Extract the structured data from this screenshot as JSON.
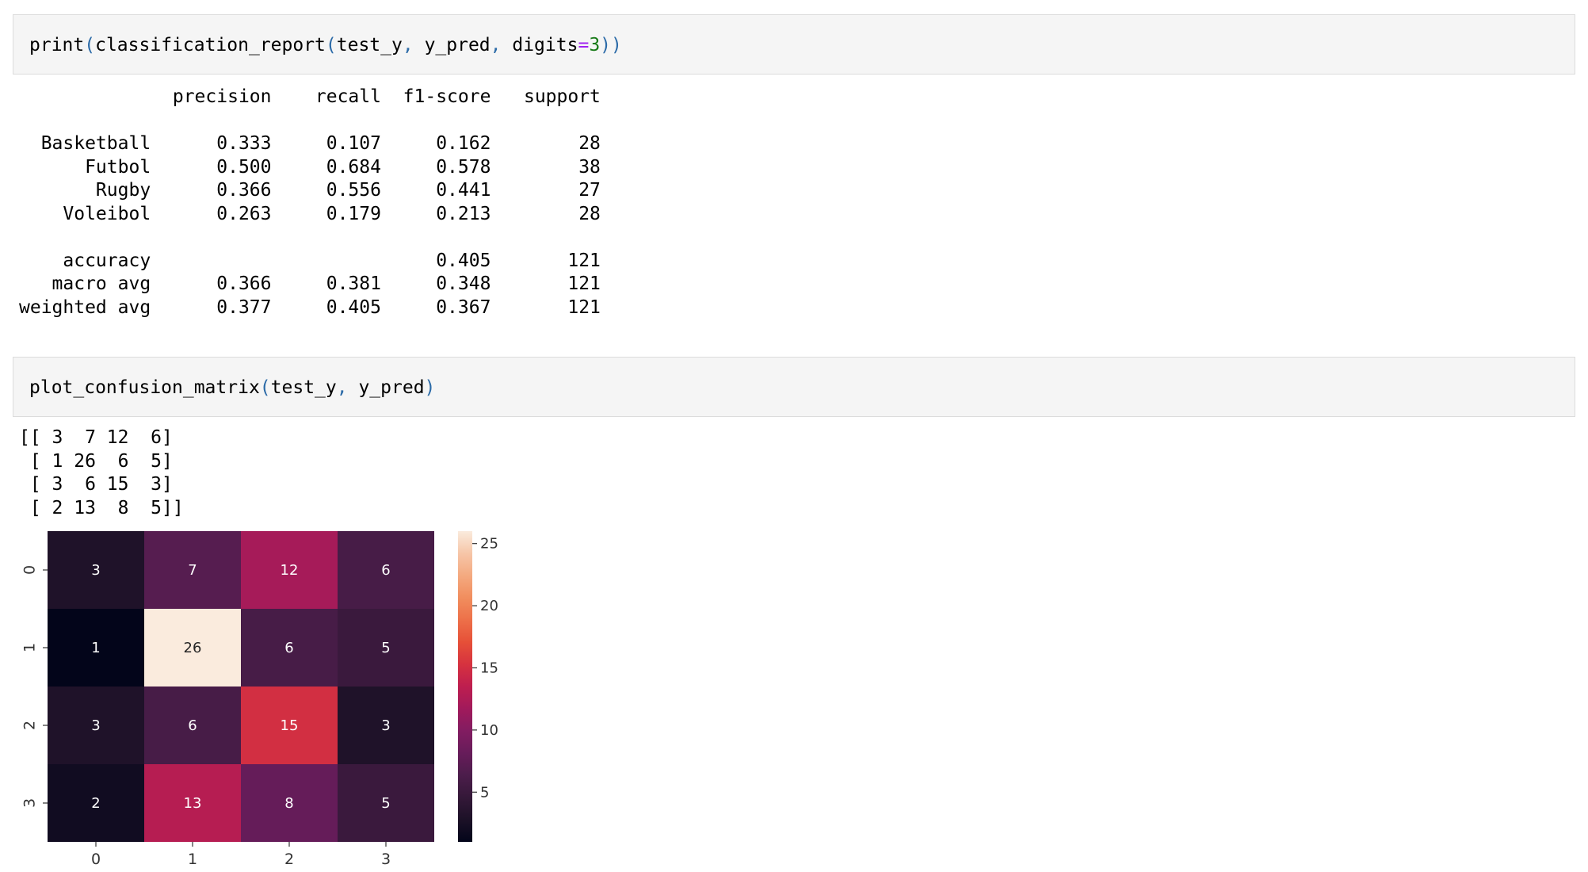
{
  "cells": [
    {
      "code": {
        "fn": "print",
        "open": "(",
        "inner_fn": "classification_report",
        "inner_open": "(",
        "arg1": "test_y",
        "comma1": ", ",
        "arg2": "y_pred",
        "comma2": ", ",
        "kw": "digits",
        "eq": "=",
        "num": "3",
        "close": "))"
      },
      "output": "              precision    recall  f1-score   support\n\n  Basketball      0.333     0.107     0.162        28\n      Futbol      0.500     0.684     0.578        38\n       Rugby      0.366     0.556     0.441        27\n    Voleibol      0.263     0.179     0.213        28\n\n    accuracy                          0.405       121\n   macro avg      0.366     0.381     0.348       121\nweighted avg      0.377     0.405     0.367       121"
    },
    {
      "code": {
        "fn": "plot_confusion_matrix",
        "open": "(",
        "arg1": "test_y",
        "comma1": ", ",
        "arg2": "y_pred",
        "close": ")"
      },
      "output": "[[ 3  7 12  6]\n [ 1 26  6  5]\n [ 3  6 15  3]\n [ 2 13  8  5]]"
    }
  ],
  "chart_data": {
    "type": "heatmap",
    "title": "",
    "xlabel": "",
    "ylabel": "",
    "x_ticks": [
      "0",
      "1",
      "2",
      "3"
    ],
    "y_ticks": [
      "0",
      "1",
      "2",
      "3"
    ],
    "matrix": [
      [
        3,
        7,
        12,
        6
      ],
      [
        1,
        26,
        6,
        5
      ],
      [
        3,
        6,
        15,
        3
      ],
      [
        2,
        13,
        8,
        5
      ]
    ],
    "colorbar": {
      "ticks": [
        "5",
        "10",
        "15",
        "20",
        "25"
      ],
      "range": [
        1,
        26
      ],
      "colormap": "rocket"
    },
    "colors": {
      "ramp": [
        "#03051a",
        "#1c1127",
        "#341838",
        "#4c1d4b",
        "#671c5a",
        "#821c61",
        "#a11a5b",
        "#be1e4f",
        "#d6323f",
        "#e65038",
        "#ed7049",
        "#f18e5e",
        "#f4aa80",
        "#f6c6a8",
        "#faebdd"
      ]
    }
  }
}
